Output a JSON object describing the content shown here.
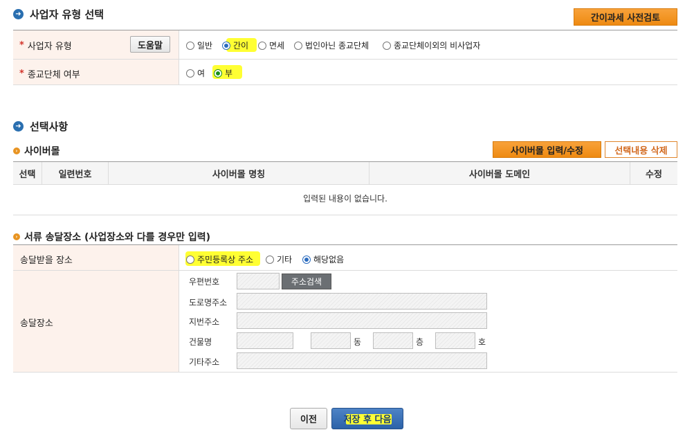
{
  "section1": {
    "title": "사업자 유형 선택",
    "precheck_button": "간이과세 사전검토",
    "business_type": {
      "label": "사업자 유형",
      "help_button": "도움말",
      "options": [
        "일반",
        "간이",
        "면세",
        "법인아닌 종교단체",
        "종교단체이외의 비사업자"
      ],
      "selected": "간이"
    },
    "religious": {
      "label": "종교단체 여부",
      "options": [
        "여",
        "부"
      ],
      "selected": "부"
    }
  },
  "section2": {
    "title": "선택사항",
    "cybermall": {
      "title": "사이버몰",
      "input_button": "사이버몰 입력/수정",
      "delete_button": "선택내용 삭제",
      "columns": [
        "선택",
        "일련번호",
        "사이버몰 명칭",
        "사이버몰 도메인",
        "수정"
      ],
      "empty_message": "입력된 내용이 없습니다."
    },
    "delivery": {
      "title": "서류 송달장소 (사업장소와 다를 경우만 입력)",
      "receive_label": "송달받을 장소",
      "receive_options": [
        "주민등록상 주소",
        "기타",
        "해당없음"
      ],
      "receive_selected": "해당없음",
      "place_label": "송달장소",
      "zip_label": "우편번호",
      "zip_search_button": "주소검색",
      "road_label": "도로명주소",
      "lot_label": "지번주소",
      "building_label": "건물명",
      "dong_unit": "동",
      "floor_unit": "층",
      "ho_unit": "호",
      "other_label": "기타주소"
    }
  },
  "footer": {
    "prev_button": "이전",
    "save_next_button": "저장 후 다음"
  }
}
